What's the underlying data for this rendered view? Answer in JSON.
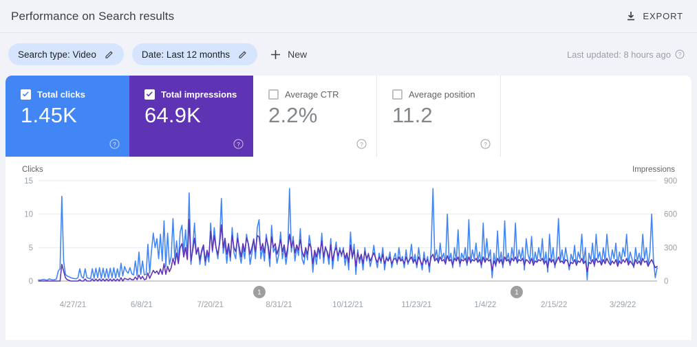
{
  "header": {
    "title": "Performance on Search results",
    "export_label": "EXPORT",
    "export_icon": "download-icon"
  },
  "filters": {
    "chips": [
      {
        "label": "Search type: Video",
        "icon": "pencil-icon"
      },
      {
        "label": "Date: Last 12 months",
        "icon": "pencil-icon"
      }
    ],
    "new_label": "New",
    "new_icon": "plus-icon",
    "last_updated": "Last updated: 8 hours ago",
    "help_icon": "question-mark-icon"
  },
  "metrics": [
    {
      "label": "Total clicks",
      "value": "1.45K",
      "checked": true,
      "color": "#4285f4"
    },
    {
      "label": "Total impressions",
      "value": "64.9K",
      "checked": true,
      "color": "#5f34b4"
    },
    {
      "label": "Average CTR",
      "value": "2.2%",
      "checked": false,
      "color": "#80868b"
    },
    {
      "label": "Average position",
      "value": "11.2",
      "checked": false,
      "color": "#80868b"
    }
  ],
  "chart_data": {
    "type": "line",
    "title": "",
    "xlabel": "",
    "grid": true,
    "legend": "none",
    "axes": {
      "left": {
        "label": "Clicks",
        "ticks": [
          0,
          5,
          10,
          15
        ],
        "ylim": [
          0,
          15
        ]
      },
      "right": {
        "label": "Impressions",
        "ticks": [
          0,
          300,
          600,
          900
        ],
        "ylim": [
          0,
          900
        ]
      }
    },
    "x_tick_labels": [
      "4/27/21",
      "6/8/21",
      "7/20/21",
      "8/31/21",
      "10/12/21",
      "11/23/21",
      "1/4/22",
      "2/15/22",
      "3/29/22"
    ],
    "annotations": [
      {
        "label": "1",
        "x_fraction": 0.357
      },
      {
        "label": "1",
        "x_fraction": 0.773
      }
    ],
    "series": [
      {
        "name": "Total impressions",
        "color": "#4285f4",
        "axis": "right",
        "values": [
          10,
          8,
          12,
          15,
          10,
          8,
          20,
          14,
          10,
          12,
          18,
          90,
          110,
          760,
          180,
          60,
          45,
          38,
          30,
          25,
          22,
          20,
          30,
          110,
          40,
          25,
          110,
          30,
          25,
          20,
          110,
          25,
          115,
          30,
          120,
          25,
          115,
          30,
          110,
          25,
          115,
          30,
          120,
          28,
          110,
          35,
          160,
          45,
          130,
          90,
          70,
          120,
          65,
          55,
          180,
          45,
          260,
          60,
          180,
          55,
          60,
          330,
          70,
          270,
          430,
          300,
          380,
          200,
          420,
          180,
          540,
          130,
          430,
          150,
          220,
          560,
          200,
          360,
          170,
          440,
          500,
          250,
          460,
          200,
          790,
          150,
          300,
          520,
          240,
          300,
          150,
          260,
          300,
          140,
          250,
          170,
          520,
          260,
          480,
          300,
          200,
          360,
          740,
          250,
          350,
          160,
          320,
          180,
          480,
          250,
          200,
          430,
          250,
          160,
          300,
          200,
          420,
          330,
          150,
          250,
          380,
          200,
          480,
          550,
          200,
          300,
          180,
          420,
          300,
          130,
          500,
          260,
          300,
          160,
          240,
          440,
          200,
          300,
          150,
          270,
          830,
          260,
          400,
          180,
          300,
          230,
          470,
          200,
          150,
          280,
          190,
          410,
          300,
          80,
          260,
          150,
          300,
          200,
          430,
          160,
          310,
          250,
          150,
          380,
          110,
          250,
          350,
          180,
          300,
          220,
          300,
          140,
          250,
          100,
          440,
          200,
          330,
          60,
          280,
          160,
          230,
          100,
          300,
          180,
          250,
          130,
          200,
          320,
          200,
          120,
          250,
          160,
          300,
          100,
          220,
          180,
          260,
          120,
          200,
          250,
          150,
          300,
          180,
          220,
          120,
          280,
          150,
          200,
          330,
          160,
          240,
          120,
          300,
          180,
          100,
          260,
          150,
          220,
          80,
          300,
          830,
          200,
          280,
          160,
          340,
          200,
          250,
          150,
          600,
          180,
          250,
          120,
          300,
          180,
          460,
          130,
          250,
          200,
          300,
          140,
          550,
          160,
          280,
          200,
          340,
          180,
          260,
          120,
          520,
          180,
          380,
          200,
          280,
          30,
          250,
          130,
          450,
          160,
          260,
          120,
          540,
          180,
          250,
          140,
          300,
          200,
          520,
          160,
          280,
          200,
          300,
          100,
          380,
          240,
          180,
          400,
          140,
          260,
          180,
          300,
          200,
          380,
          150,
          260,
          80,
          420,
          180,
          300,
          120,
          240,
          560,
          180,
          280,
          160,
          300,
          200,
          100,
          240,
          180,
          320,
          140,
          260,
          200,
          420,
          160,
          300,
          10,
          250,
          180,
          340,
          130,
          420,
          200,
          260,
          150,
          300,
          180,
          420,
          240,
          160,
          280,
          200,
          340,
          140,
          260,
          180,
          300,
          220,
          420,
          150,
          260,
          200,
          120,
          300,
          180,
          250,
          160,
          420,
          200,
          300,
          140,
          260,
          600,
          180,
          30,
          120
        ]
      },
      {
        "name": "Total clicks",
        "color": "#5f34b4",
        "axis": "left",
        "values": [
          0,
          0,
          0,
          0,
          0,
          0,
          0,
          0,
          0,
          0,
          0,
          0,
          0,
          2.5,
          1.5,
          0.5,
          0.2,
          0.1,
          0,
          0,
          0,
          0,
          0,
          0.2,
          0,
          0,
          0.3,
          0,
          0,
          0,
          0.3,
          0,
          0.3,
          0,
          0.3,
          0,
          0.3,
          0,
          0.3,
          0,
          0.3,
          0,
          0.3,
          0,
          0.3,
          0,
          0.5,
          0,
          0.4,
          0.3,
          0.2,
          0.4,
          0.2,
          0.2,
          0.6,
          0.2,
          0.9,
          0.3,
          0.7,
          0.2,
          0.3,
          1.2,
          0.4,
          1.0,
          1.6,
          1.2,
          1.5,
          1.0,
          1.8,
          1.0,
          2.6,
          1.0,
          2.2,
          1.4,
          2.0,
          3.4,
          2.4,
          4.2,
          2.6,
          5.0,
          5.6,
          3.6,
          5.0,
          3.2,
          9.2,
          3.0,
          4.6,
          6.4,
          4.0,
          5.0,
          3.2,
          4.6,
          5.4,
          3.0,
          4.6,
          3.6,
          7.4,
          4.6,
          6.8,
          5.0,
          4.0,
          5.6,
          8.4,
          5.0,
          6.4,
          4.0,
          5.6,
          3.6,
          6.8,
          5.0,
          4.4,
          6.4,
          5.0,
          3.6,
          5.6,
          4.4,
          6.4,
          5.6,
          4.0,
          5.0,
          6.2,
          4.4,
          6.8,
          6.6,
          4.6,
          5.6,
          4.2,
          6.4,
          5.4,
          3.4,
          6.6,
          5.0,
          5.6,
          4.0,
          5.0,
          6.2,
          4.4,
          5.4,
          3.6,
          5.0,
          7.0,
          5.0,
          6.0,
          4.2,
          5.4,
          4.6,
          6.2,
          4.4,
          3.6,
          5.0,
          4.0,
          5.6,
          5.0,
          2.6,
          4.6,
          3.6,
          5.0,
          4.2,
          6.0,
          3.6,
          5.0,
          4.4,
          3.4,
          5.4,
          3.0,
          4.4,
          5.0,
          3.8,
          4.6,
          4.0,
          4.6,
          3.4,
          4.2,
          2.8,
          5.4,
          3.6,
          4.6,
          2.2,
          4.2,
          3.2,
          4.0,
          2.6,
          4.4,
          3.4,
          4.0,
          3.0,
          3.6,
          4.2,
          3.4,
          2.8,
          3.6,
          3.0,
          4.0,
          2.6,
          3.4,
          3.0,
          3.6,
          2.6,
          3.2,
          3.4,
          2.8,
          3.6,
          3.0,
          3.2,
          2.6,
          3.6,
          2.8,
          3.2,
          3.6,
          2.8,
          3.2,
          2.4,
          3.6,
          3.0,
          2.4,
          3.4,
          2.8,
          3.2,
          2.2,
          3.6,
          4.0,
          3.0,
          3.4,
          2.8,
          3.6,
          3.0,
          3.2,
          2.6,
          3.8,
          3.0,
          3.2,
          2.4,
          3.4,
          3.0,
          3.6,
          2.6,
          3.2,
          3.0,
          3.4,
          2.6,
          3.6,
          2.8,
          3.2,
          3.0,
          3.4,
          2.8,
          3.2,
          2.4,
          3.6,
          2.8,
          3.4,
          3.0,
          3.2,
          1.6,
          3.0,
          2.4,
          3.4,
          2.8,
          3.2,
          2.4,
          3.6,
          3.0,
          3.2,
          2.6,
          3.4,
          3.0,
          3.6,
          2.8,
          3.2,
          3.0,
          3.4,
          2.4,
          3.2,
          3.0,
          2.6,
          3.4,
          2.4,
          3.0,
          2.8,
          3.2,
          3.0,
          3.4,
          2.6,
          3.0,
          2.0,
          3.4,
          2.8,
          3.2,
          2.4,
          3.0,
          3.6,
          2.8,
          3.0,
          2.6,
          3.2,
          3.0,
          2.2,
          2.8,
          2.6,
          3.2,
          2.4,
          3.0,
          2.8,
          3.4,
          2.6,
          3.0,
          1.4,
          2.8,
          2.6,
          3.2,
          2.4,
          3.4,
          2.8,
          3.0,
          2.4,
          3.2,
          2.6,
          3.4,
          2.8,
          2.4,
          3.0,
          2.6,
          3.2,
          2.2,
          3.0,
          2.6,
          3.2,
          2.8,
          3.4,
          2.4,
          3.0,
          2.6,
          2.2,
          3.2,
          2.6,
          3.0,
          2.4,
          3.4,
          2.8,
          3.0,
          2.2,
          2.8,
          3.2,
          2.6,
          2.0,
          2.2
        ]
      }
    ]
  }
}
